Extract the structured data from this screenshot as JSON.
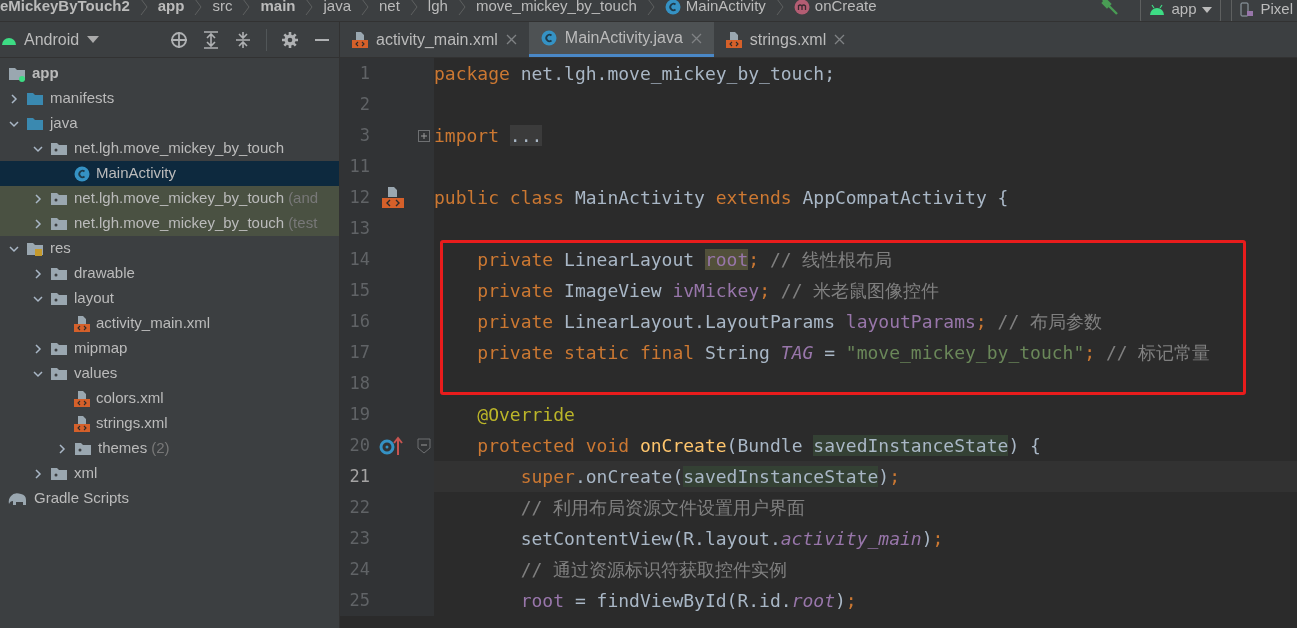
{
  "breadcrumbs": [
    {
      "label": "eMickeyByTouch2",
      "kind": "text",
      "bold": true
    },
    {
      "label": "app",
      "kind": "text",
      "bold": true
    },
    {
      "label": "src",
      "kind": "text",
      "bold": false
    },
    {
      "label": "main",
      "kind": "text",
      "bold": true
    },
    {
      "label": "java",
      "kind": "text",
      "bold": false
    },
    {
      "label": "net",
      "kind": "text",
      "bold": false
    },
    {
      "label": "lgh",
      "kind": "text",
      "bold": false
    },
    {
      "label": "move_mickey_by_touch",
      "kind": "text",
      "bold": false
    },
    {
      "label": "MainActivity",
      "kind": "class",
      "bold": false
    },
    {
      "label": "onCreate",
      "kind": "method",
      "bold": false
    }
  ],
  "run_config": {
    "label": "app"
  },
  "device": {
    "label": "Pixel"
  },
  "project_view": {
    "label": "Android"
  },
  "tabs": [
    {
      "label": "activity_main.xml",
      "kind": "xml",
      "selected": false
    },
    {
      "label": "MainActivity.java",
      "kind": "class",
      "selected": true
    },
    {
      "label": "strings.xml",
      "kind": "xml",
      "selected": false
    }
  ],
  "tree": [
    {
      "label": "app",
      "kind": "module",
      "expanded": true,
      "selected": false,
      "children": [
        {
          "label": "manifests",
          "kind": "folder",
          "expanded": false,
          "selected": false
        },
        {
          "label": "java",
          "kind": "folder",
          "expanded": true,
          "selected": false,
          "children": [
            {
              "label": "net.lgh.move_mickey_by_touch",
              "kind": "package",
              "expanded": true,
              "selected": false,
              "children": [
                {
                  "label": "MainActivity",
                  "kind": "class",
                  "selected": true
                }
              ]
            },
            {
              "label": "net.lgh.move_mickey_by_touch",
              "suffix": "(and",
              "kind": "package",
              "expanded": false,
              "selected": false,
              "tinted": true
            },
            {
              "label": "net.lgh.move_mickey_by_touch",
              "suffix": "(test",
              "kind": "package",
              "expanded": false,
              "selected": false,
              "tinted": true
            }
          ]
        },
        {
          "label": "res",
          "kind": "res",
          "expanded": true,
          "selected": false,
          "children": [
            {
              "label": "drawable",
              "kind": "package",
              "expanded": false,
              "selected": false
            },
            {
              "label": "layout",
              "kind": "package",
              "expanded": true,
              "selected": false,
              "children": [
                {
                  "label": "activity_main.xml",
                  "kind": "xml",
                  "selected": false
                }
              ]
            },
            {
              "label": "mipmap",
              "kind": "package",
              "expanded": false,
              "selected": false
            },
            {
              "label": "values",
              "kind": "package",
              "expanded": true,
              "selected": false,
              "children": [
                {
                  "label": "colors.xml",
                  "kind": "xml",
                  "selected": false
                },
                {
                  "label": "strings.xml",
                  "kind": "xml",
                  "selected": false
                },
                {
                  "label": "themes",
                  "suffix": "(2)",
                  "kind": "package",
                  "expanded": false,
                  "selected": false
                }
              ]
            },
            {
              "label": "xml",
              "kind": "package",
              "expanded": false,
              "selected": false
            }
          ]
        }
      ]
    },
    {
      "label": "Gradle Scripts",
      "kind": "gradle",
      "selected": false
    }
  ],
  "code_lines": [
    {
      "number": "1",
      "tokens": [
        {
          "kind": "keyword",
          "text": "package"
        },
        {
          "kind": "plain",
          "text": " net.lgh.move_mickey_by_touch;"
        }
      ]
    },
    {
      "number": "2"
    },
    {
      "number": "3",
      "fold": {
        "collapsed": true
      },
      "tokens": [
        {
          "kind": "keyword",
          "text": "import "
        },
        {
          "kind": "folded",
          "text": "..."
        }
      ]
    },
    {
      "number": "11"
    },
    {
      "number": "12",
      "gutter": {
        "kind": "layout"
      },
      "tokens": [
        {
          "kind": "keyword",
          "text": "public class "
        },
        {
          "kind": "plain",
          "text": "MainActivity "
        },
        {
          "kind": "keyword",
          "text": "extends "
        },
        {
          "kind": "plain",
          "text": "AppCompatActivity {"
        }
      ]
    },
    {
      "number": "13"
    },
    {
      "number": "14",
      "boxed": true,
      "tokens": [
        {
          "kind": "keyword",
          "text": "    private "
        },
        {
          "kind": "plain",
          "text": "LinearLayout "
        },
        {
          "kind": "field_usage",
          "text": "root"
        },
        {
          "kind": "keyword",
          "text": ";"
        },
        {
          "kind": "comment",
          "text": " // 线性根布局"
        }
      ]
    },
    {
      "number": "15",
      "boxed": true,
      "tokens": [
        {
          "kind": "keyword",
          "text": "    private "
        },
        {
          "kind": "plain",
          "text": "ImageView "
        },
        {
          "kind": "field",
          "text": "ivMickey"
        },
        {
          "kind": "keyword",
          "text": ";"
        },
        {
          "kind": "comment",
          "text": " // 米老鼠图像控件"
        }
      ]
    },
    {
      "number": "16",
      "boxed": true,
      "tokens": [
        {
          "kind": "keyword",
          "text": "    private "
        },
        {
          "kind": "plain",
          "text": "LinearLayout.LayoutParams "
        },
        {
          "kind": "field",
          "text": "layoutParams"
        },
        {
          "kind": "keyword",
          "text": ";"
        },
        {
          "kind": "comment",
          "text": " // 布局参数"
        }
      ]
    },
    {
      "number": "17",
      "boxed": true,
      "tokens": [
        {
          "kind": "keyword",
          "text": "    private static final "
        },
        {
          "kind": "plain",
          "text": "String "
        },
        {
          "kind": "static",
          "text": "TAG"
        },
        {
          "kind": "plain",
          "text": " = "
        },
        {
          "kind": "string",
          "text": "\"move_mickey_by_touch\""
        },
        {
          "kind": "keyword",
          "text": ";"
        },
        {
          "kind": "comment",
          "text": " // 标记常量"
        }
      ]
    },
    {
      "number": "18",
      "boxed": true
    },
    {
      "number": "19",
      "tokens": [
        {
          "kind": "annotation",
          "text": "    @Override"
        }
      ]
    },
    {
      "number": "20",
      "gutter": {
        "kind": "override"
      },
      "fold": {
        "collapsed": false
      },
      "tokens": [
        {
          "kind": "keyword",
          "text": "    protected void "
        },
        {
          "kind": "method",
          "text": "onCreate"
        },
        {
          "kind": "plain",
          "text": "(Bundle "
        },
        {
          "kind": "param_usage",
          "text": "savedInstanceState"
        },
        {
          "kind": "plain",
          "text": ") {"
        }
      ]
    },
    {
      "number": "21",
      "current": true,
      "tokens": [
        {
          "kind": "keyword",
          "text": "        super"
        },
        {
          "kind": "plain",
          "text": ".onCreate("
        },
        {
          "kind": "param_usage",
          "text": "savedInstanceState"
        },
        {
          "kind": "plain",
          "text": ")"
        },
        {
          "kind": "keyword",
          "text": ";"
        }
      ]
    },
    {
      "number": "22",
      "tokens": [
        {
          "kind": "comment",
          "text": "        // 利用布局资源文件设置用户界面"
        }
      ]
    },
    {
      "number": "23",
      "tokens": [
        {
          "kind": "plain",
          "text": "        setContentView(R.layout."
        },
        {
          "kind": "static",
          "text": "activity_main"
        },
        {
          "kind": "plain",
          "text": ")"
        },
        {
          "kind": "keyword",
          "text": ";"
        }
      ]
    },
    {
      "number": "24",
      "tokens": [
        {
          "kind": "comment",
          "text": "        // 通过资源标识符获取控件实例"
        }
      ]
    },
    {
      "number": "25",
      "tokens": [
        {
          "kind": "field",
          "text": "        root"
        },
        {
          "kind": "plain",
          "text": " = findViewById(R.id."
        },
        {
          "kind": "static",
          "text": "root"
        },
        {
          "kind": "plain",
          "text": ")"
        },
        {
          "kind": "keyword",
          "text": ";"
        }
      ]
    }
  ]
}
